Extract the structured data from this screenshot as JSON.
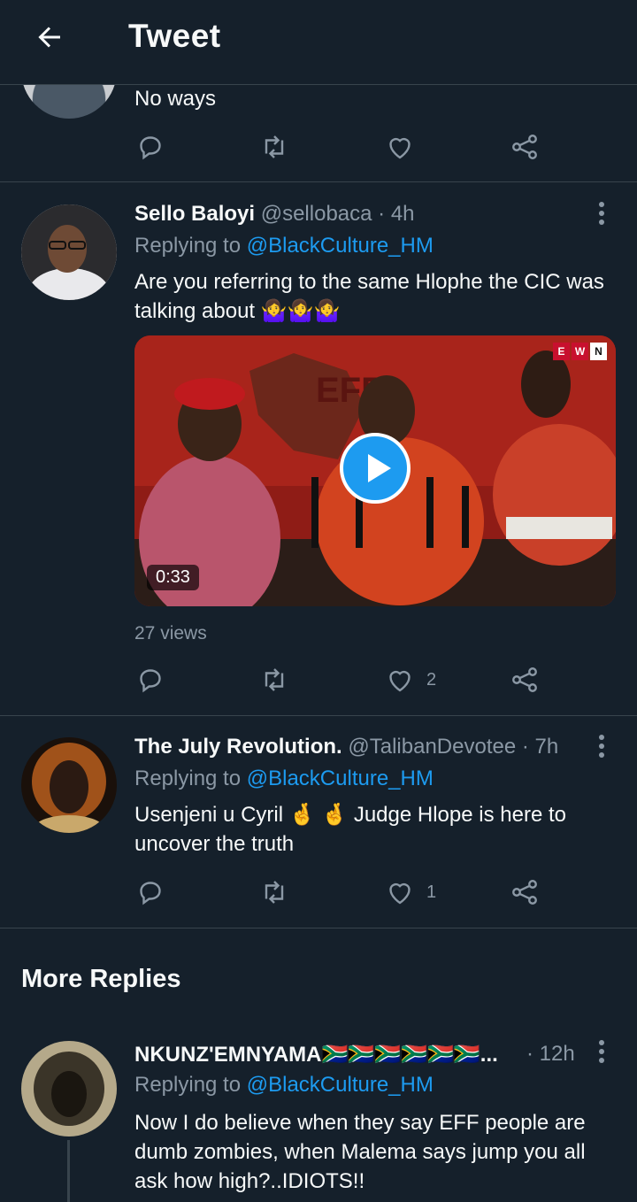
{
  "header": {
    "title": "Tweet"
  },
  "partial_tweet": {
    "text": "No ways"
  },
  "tweets": [
    {
      "name": "Sello Baloyi",
      "handle": "@sellobaca",
      "time": "· 4h",
      "replying_prefix": "Replying to ",
      "replying_to": "@BlackCulture_HM",
      "text": "Are you referring to the same Hlophe the CIC was talking about 🤷‍♀️🤷‍♀️🤷‍♀️",
      "video_duration": "0:33",
      "views": "27 views",
      "likes": "2",
      "video_logo": [
        "E",
        "W",
        "N"
      ]
    },
    {
      "name": "The July Revolution.",
      "handle": "@TalibanDevotee",
      "time": "· 7h",
      "replying_prefix": "Replying to ",
      "replying_to": "@BlackCulture_HM",
      "text": "Usenjeni u Cyril 🤞 🤞 Judge Hlope is here to uncover the truth",
      "likes": "1"
    }
  ],
  "more_replies": {
    "title": "More Replies",
    "tweet": {
      "name": "NKUNZ'EMNYAMA🇿🇦🇿🇦🇿🇦🇿🇦🇿🇦🇿🇦...",
      "time": "· 12h",
      "replying_prefix": "Replying to ",
      "replying_to": "@BlackCulture_HM",
      "text": "Now I do believe when they say EFF people are dumb zombies, when Malema says jump you all ask how high?..IDIOTS!!"
    }
  },
  "colors": {
    "background": "#15202b",
    "accent": "#1d9bf0",
    "muted": "#8b98a5",
    "divider": "#38444d"
  }
}
